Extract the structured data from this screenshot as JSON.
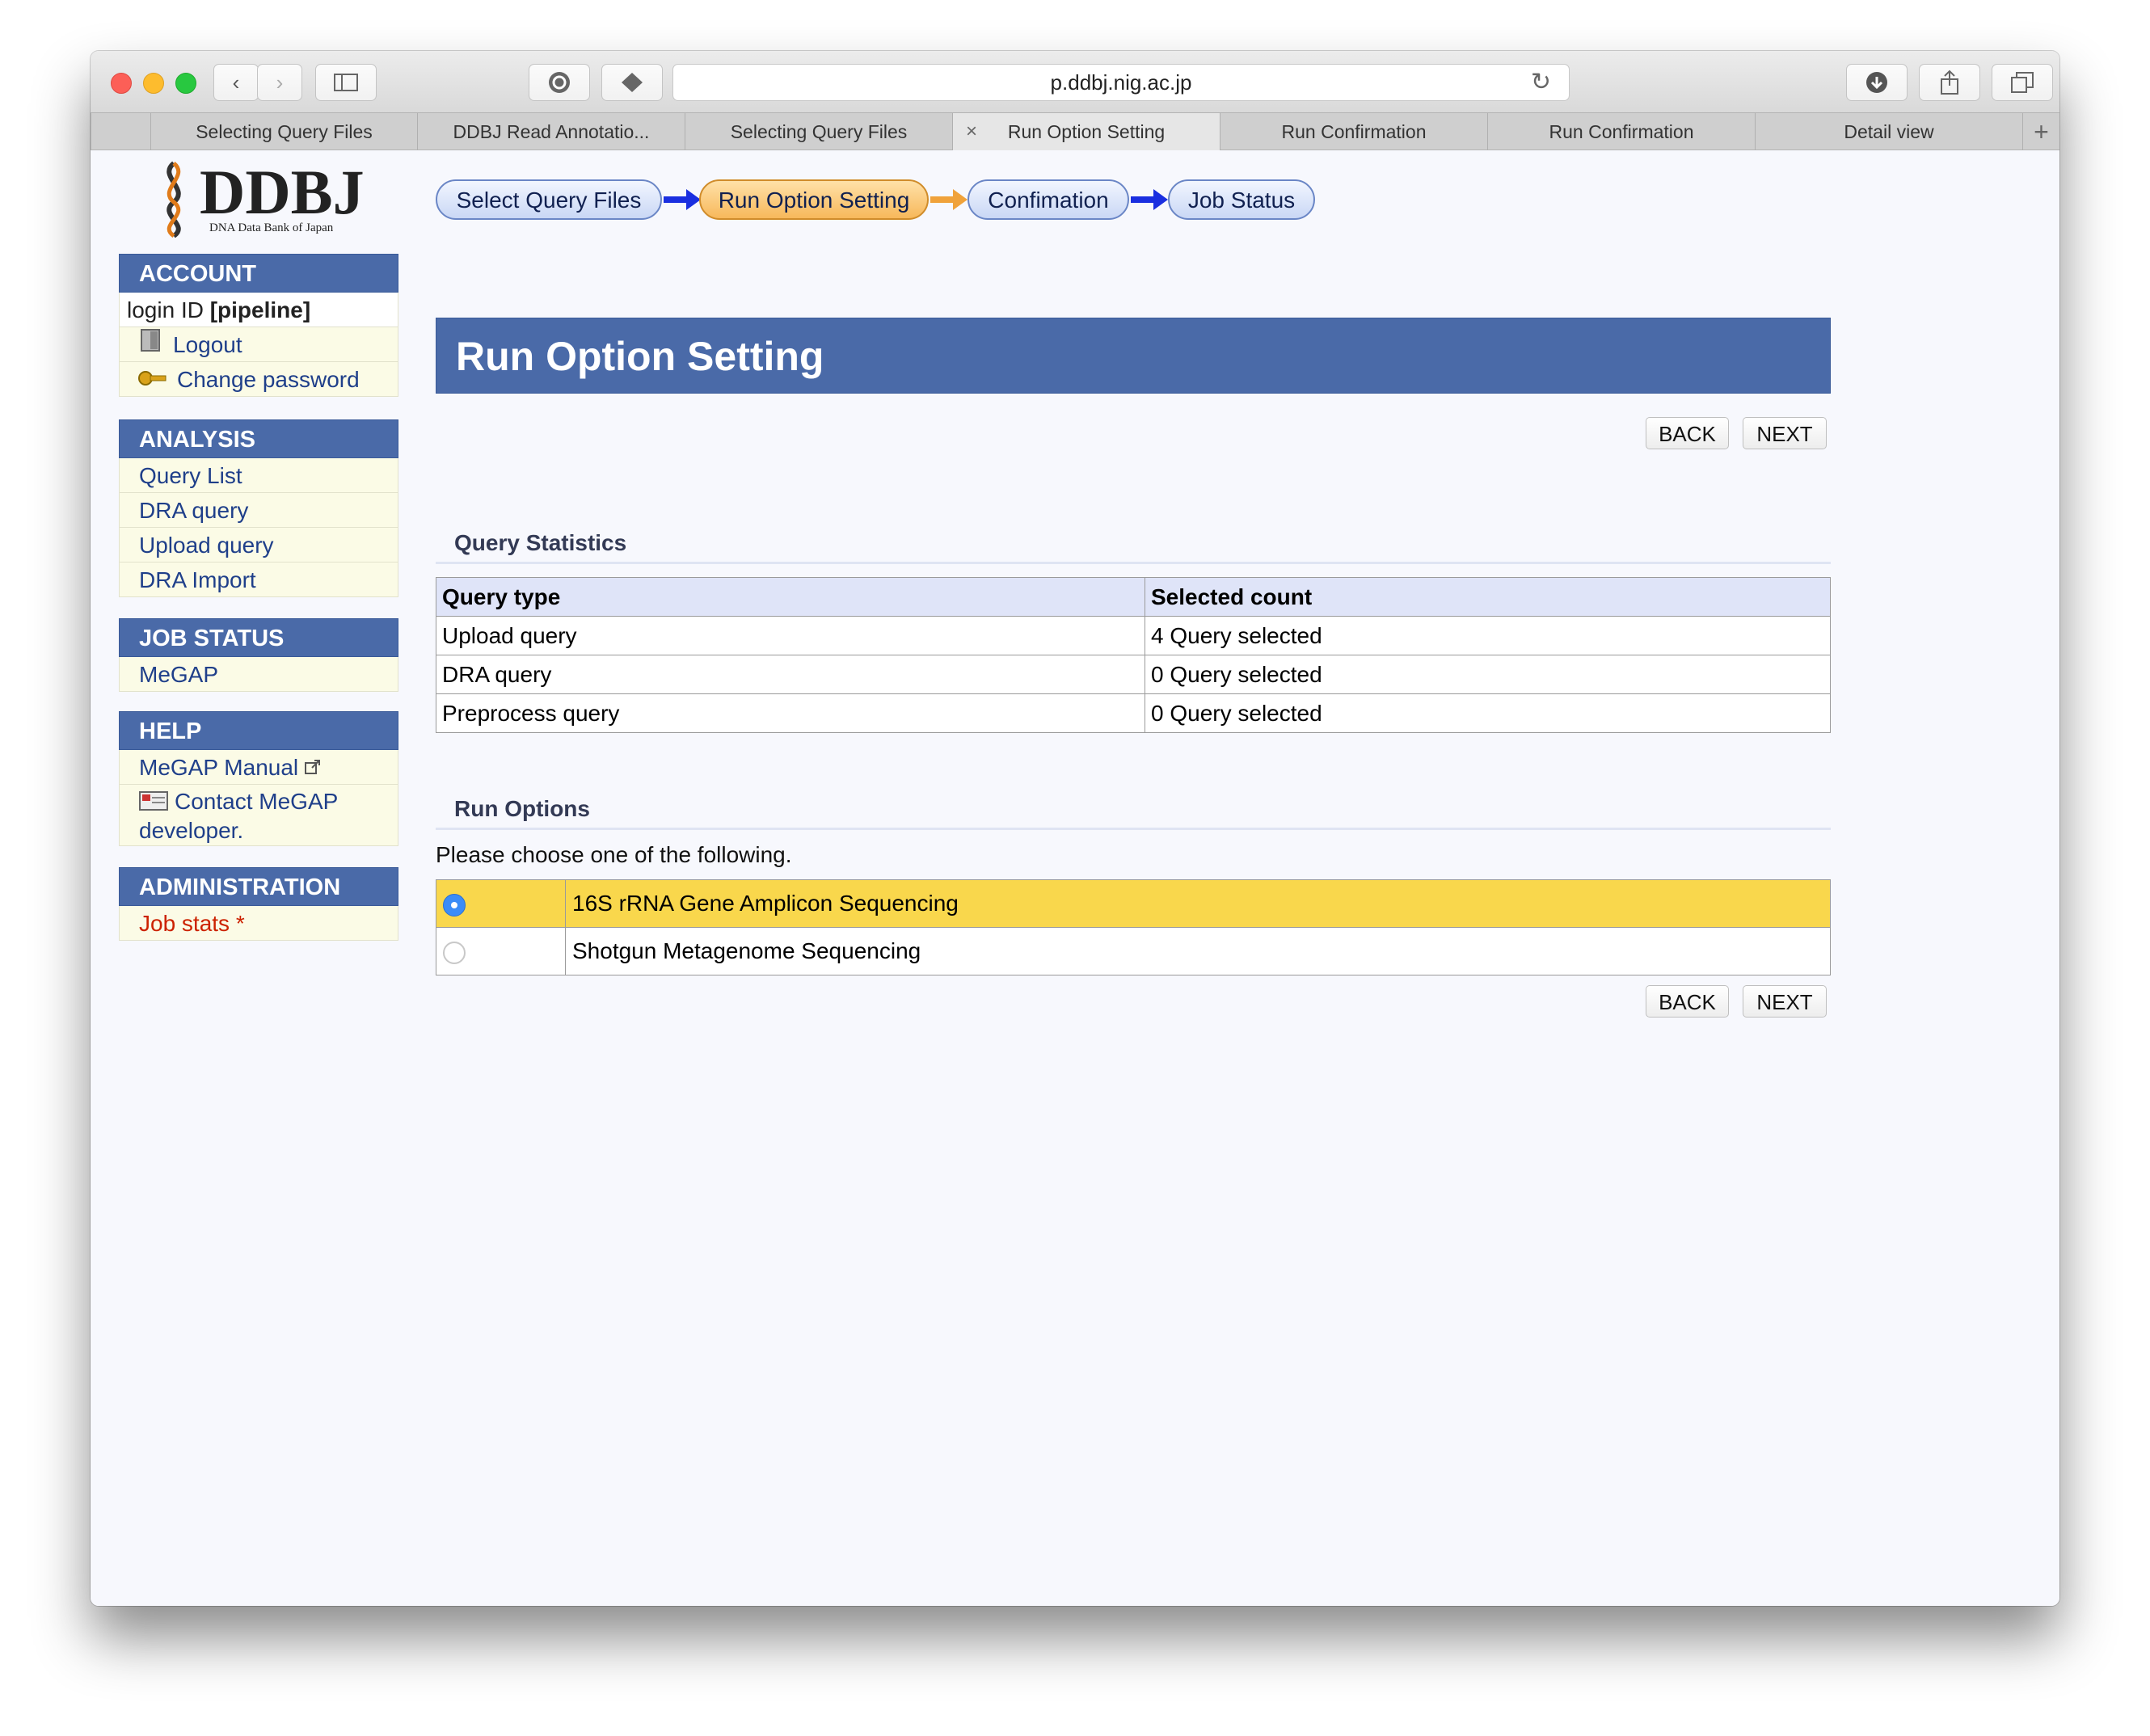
{
  "browser": {
    "url": "p.ddbj.nig.ac.jp",
    "tabs": [
      {
        "label": "Selecting Query Files",
        "active": false
      },
      {
        "label": "DDBJ Read Annotatio...",
        "active": false
      },
      {
        "label": "Selecting Query Files",
        "active": false
      },
      {
        "label": "Run Option Setting",
        "active": true
      },
      {
        "label": "Run Confirmation",
        "active": false
      },
      {
        "label": "Run Confirmation",
        "active": false
      },
      {
        "label": "Detail view",
        "active": false
      }
    ],
    "close_tab_glyph": "×",
    "new_tab_glyph": "+"
  },
  "logo": {
    "text": "DDBJ",
    "subtitle": "DNA Data Bank of Japan"
  },
  "sidebar": {
    "account": {
      "title": "ACCOUNT",
      "login_prefix": "login ID ",
      "login_id": "[pipeline]",
      "items": [
        {
          "label": "Logout",
          "icon": "door-icon"
        },
        {
          "label": "Change password",
          "icon": "key-icon"
        }
      ]
    },
    "analysis": {
      "title": "ANALYSIS",
      "items": [
        "Query List",
        "DRA query",
        "Upload query",
        "DRA Import"
      ]
    },
    "job_status": {
      "title": "JOB STATUS",
      "items": [
        "MeGAP"
      ]
    },
    "help": {
      "title": "HELP",
      "manual": "MeGAP Manual",
      "contact_line1": "Contact MeGAP",
      "contact_line2": "developer."
    },
    "administration": {
      "title": "ADMINISTRATION",
      "items": [
        "Job stats *"
      ],
      "item_color": "#cc2200"
    }
  },
  "steps": [
    {
      "label": "Select Query Files",
      "active": false
    },
    {
      "label": "Run Option Setting",
      "active": true
    },
    {
      "label": "Confimation",
      "active": false
    },
    {
      "label": "Job Status",
      "active": false
    }
  ],
  "page_title": "Run Option Setting",
  "buttons": {
    "back": "BACK",
    "next": "NEXT"
  },
  "query_statistics": {
    "title": "Query Statistics",
    "headers": [
      "Query type",
      "Selected count"
    ],
    "rows": [
      [
        "Upload query",
        "4 Query selected"
      ],
      [
        "DRA query",
        "0 Query selected"
      ],
      [
        "Preprocess query",
        "0 Query selected"
      ]
    ]
  },
  "run_options": {
    "title": "Run Options",
    "instruction": "Please choose one of the following.",
    "options": [
      {
        "label": "16S rRNA Gene Amplicon Sequencing",
        "selected": true
      },
      {
        "label": "Shotgun Metagenome Sequencing",
        "selected": false
      }
    ]
  },
  "colors": {
    "header_blue": "#4a6aa8",
    "selected_row": "#f9d74c",
    "active_step": "#f7b85b"
  }
}
